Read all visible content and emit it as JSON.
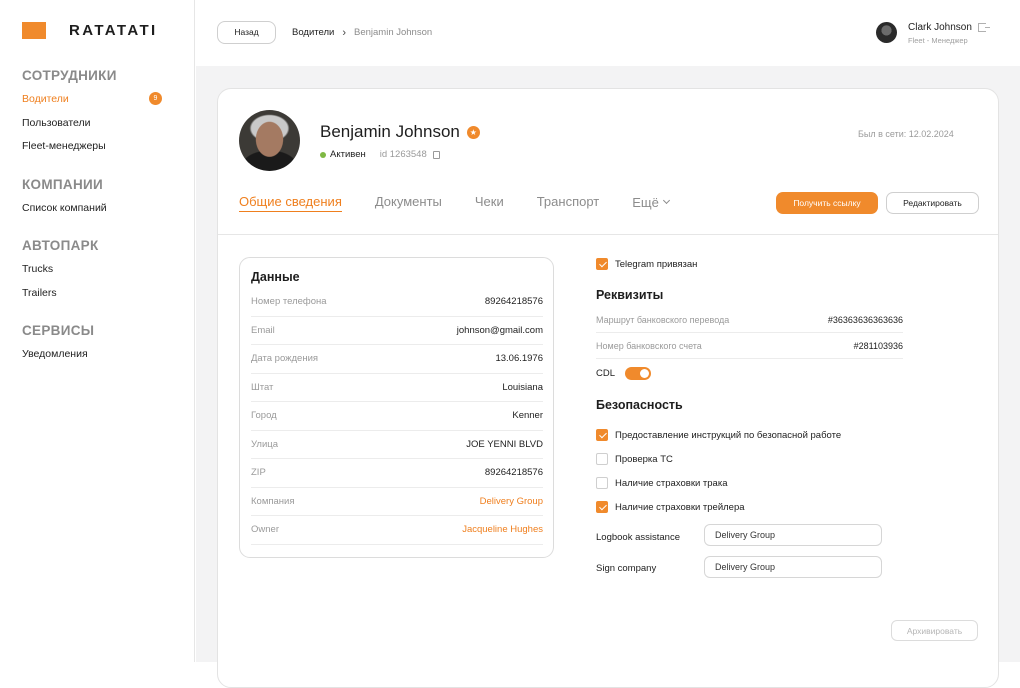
{
  "brand": {
    "name": "RATATATI",
    "accent": "#f08a2c"
  },
  "sidebar": {
    "sections": [
      {
        "heading": "СОТРУДНИКИ",
        "items": [
          {
            "label": "Водители",
            "badge": "9",
            "active": true
          },
          {
            "label": "Пользователи"
          },
          {
            "label": "Fleet-менеджеры"
          }
        ]
      },
      {
        "heading": "КОМПАНИИ",
        "items": [
          {
            "label": "Список компаний"
          }
        ]
      },
      {
        "heading": "АВТОПАРК",
        "items": [
          {
            "label": "Trucks"
          },
          {
            "label": "Trailers"
          }
        ]
      },
      {
        "heading": "СЕРВИСЫ",
        "items": [
          {
            "label": "Уведомления"
          }
        ]
      }
    ]
  },
  "topbar": {
    "back_label": "Назад",
    "breadcrumb": {
      "root": "Водители",
      "current": "Benjamin Johnson"
    },
    "user": {
      "name": "Clark Johnson",
      "role": "Fleet - Менеджер"
    }
  },
  "profile": {
    "name": "Benjamin Johnson",
    "status": "Активен",
    "id": "id 1263548",
    "last_online": "Был в сети: 12.02.2024",
    "status_color": "#7fb843"
  },
  "tabs": [
    {
      "label": "Общие сведения",
      "active": true
    },
    {
      "label": "Документы"
    },
    {
      "label": "Чеки"
    },
    {
      "label": "Транспорт"
    },
    {
      "label": "Ещё"
    }
  ],
  "actions": {
    "get_link": "Получить ссылку",
    "edit": "Редактировать",
    "archive": "Архивировать"
  },
  "data": {
    "title": "Данные",
    "rows": [
      {
        "label": "Номер телефона",
        "value": "89264218576"
      },
      {
        "label": "Email",
        "value": "johnson@gmail.com"
      },
      {
        "label": "Дата рождения",
        "value": "13.06.1976"
      },
      {
        "label": "Штат",
        "value": "Louisiana"
      },
      {
        "label": "Город",
        "value": "Kenner"
      },
      {
        "label": "Улица",
        "value": "JOE YENNI BLVD"
      },
      {
        "label": "ZIP",
        "value": "89264218576"
      },
      {
        "label": "Компания",
        "value": "Delivery Group"
      },
      {
        "label": "Owner",
        "value": "Jacqueline Hughes"
      }
    ]
  },
  "telegram": {
    "label": "Telegram привязан",
    "checked": true
  },
  "requisites": {
    "title": "Реквизиты",
    "rows": [
      {
        "label": "Маршрут банковского перевода",
        "value": "#36363636363636"
      },
      {
        "label": "Номер банковского счета",
        "value": "#281103936"
      }
    ],
    "cdl_label": "CDL",
    "cdl_on": true
  },
  "security": {
    "title": "Безопасность",
    "items": [
      {
        "label": "Предоставление инструкций по безопасной работе",
        "checked": true
      },
      {
        "label": "Проверка ТС",
        "checked": false
      },
      {
        "label": "Наличие страховки трака",
        "checked": false
      },
      {
        "label": "Наличие страховки трейлера",
        "checked": true
      }
    ],
    "logbook_label": "Logbook assistance",
    "logbook_value": "Delivery Group",
    "sign_label": "Sign company",
    "sign_value": "Delivery Group"
  }
}
